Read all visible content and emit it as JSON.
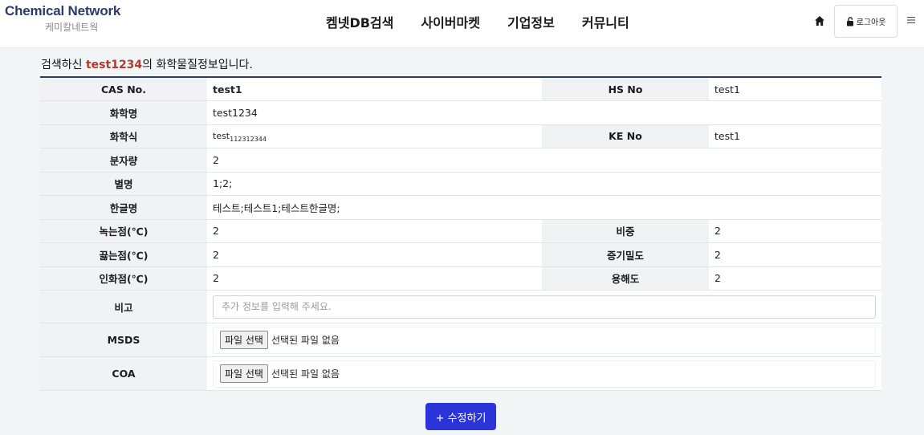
{
  "header": {
    "logo_en": "Chemical Network",
    "logo_ko": "케미칼네트웍",
    "nav": [
      "켐넷DB검색",
      "사이버마켓",
      "기업정보",
      "커뮤니티"
    ],
    "logout_label": "로그아웃",
    "icons": {
      "home": "home-icon",
      "lock": "unlock-icon",
      "menu": "hamburger-icon"
    }
  },
  "heading": {
    "prefix": "검색하신 ",
    "keyword": "test1234",
    "suffix": "의 화학물질정보입니다."
  },
  "table": {
    "cas_label": "CAS No.",
    "cas_value": "test1",
    "hs_label": "HS No",
    "hs_value": "test1",
    "name_label": "화학명",
    "name_value": "test1234",
    "formula_label": "화학식",
    "formula_main": "test",
    "formula_sub": "112312344",
    "ke_label": "KE No",
    "ke_value": "test1",
    "mw_label": "분자량",
    "mw_value": "2",
    "alias_label": "별명",
    "alias_value": "1;2;",
    "korean_label": "한글명",
    "korean_value": "테스트;테스트1;테스트한글명;",
    "melting_label": "녹는점(℃)",
    "melting_value": "2",
    "gravity_label": "비중",
    "gravity_value": "2",
    "boiling_label": "끓는점(℃)",
    "boiling_value": "2",
    "vapor_label": "증기밀도",
    "vapor_value": "2",
    "flash_label": "인화점(℃)",
    "flash_value": "2",
    "solubility_label": "용해도",
    "solubility_value": "2",
    "note_label": "비고",
    "note_placeholder": "추가 정보를 입력해 주세요.",
    "msds_label": "MSDS",
    "coa_label": "COA",
    "file_button": "파일 선택",
    "file_none": "선택된 파일 없음"
  },
  "edit_button": "+ 수정하기",
  "colors": {
    "brand": "#2d3a6b",
    "keyword": "#b03a2e",
    "button": "#2b34d9"
  }
}
